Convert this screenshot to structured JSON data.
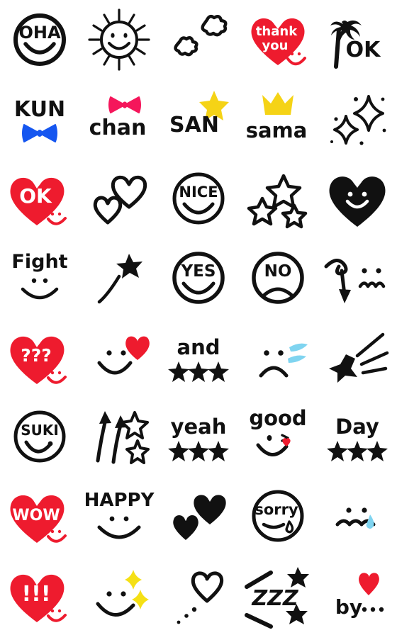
{
  "sheet": {
    "title": "Handwritten Emoji Sticker Set",
    "columns": 5,
    "rows": 8,
    "cell_size": 112,
    "background": "#ffffff"
  },
  "palette": {
    "ink": "#111111",
    "red": "#EE1B2E",
    "pink": "#F5165B",
    "blue": "#1556F0",
    "yellow": "#F5D316",
    "sparkle_yellow": "#F5E015",
    "tear_blue": "#7FD4F0",
    "white": "#FFFFFF"
  },
  "stickers": [
    {
      "id": "oha-circle-face",
      "row": 1,
      "col": 1,
      "text": "OHA",
      "kind": "circle-face-text",
      "mood": "smile",
      "colors": [
        "#111111",
        "#FFFFFF"
      ]
    },
    {
      "id": "sun-face",
      "row": 1,
      "col": 2,
      "text": "",
      "kind": "sun-face",
      "mood": "smile",
      "colors": [
        "#111111",
        "#FFFFFF"
      ]
    },
    {
      "id": "clouds",
      "row": 1,
      "col": 3,
      "text": "",
      "kind": "clouds",
      "mood": "none",
      "colors": [
        "#111111",
        "#FFFFFF"
      ]
    },
    {
      "id": "thank-you-heart",
      "row": 1,
      "col": 4,
      "text": "thank you",
      "kind": "heart-text",
      "mood": "smile",
      "colors": [
        "#EE1B2E",
        "#FFFFFF"
      ]
    },
    {
      "id": "palm-tree-ok",
      "row": 1,
      "col": 5,
      "text": "OK",
      "kind": "palm-tree-text",
      "mood": "none",
      "colors": [
        "#111111"
      ]
    },
    {
      "id": "kun-blue-bow",
      "row": 2,
      "col": 1,
      "text": "KUN",
      "kind": "text-with-bow",
      "mood": "none",
      "colors": [
        "#111111",
        "#1556F0"
      ]
    },
    {
      "id": "chan-pink-bow",
      "row": 2,
      "col": 2,
      "text": "chan",
      "kind": "text-with-bow",
      "mood": "none",
      "colors": [
        "#111111",
        "#F5165B"
      ]
    },
    {
      "id": "san-star",
      "row": 2,
      "col": 3,
      "text": "SAN",
      "kind": "text-with-star",
      "mood": "none",
      "colors": [
        "#111111",
        "#F5D316"
      ]
    },
    {
      "id": "sama-crown",
      "row": 2,
      "col": 4,
      "text": "sama",
      "kind": "text-with-crown",
      "mood": "none",
      "colors": [
        "#111111",
        "#F5D316"
      ]
    },
    {
      "id": "sparkles",
      "row": 2,
      "col": 5,
      "text": "",
      "kind": "sparkles",
      "mood": "none",
      "colors": [
        "#111111",
        "#FFFFFF"
      ]
    },
    {
      "id": "ok-heart",
      "row": 3,
      "col": 1,
      "text": "OK",
      "kind": "heart-text",
      "mood": "smile",
      "colors": [
        "#EE1B2E",
        "#FFFFFF"
      ]
    },
    {
      "id": "two-white-hearts",
      "row": 3,
      "col": 2,
      "text": "",
      "kind": "two-hearts",
      "mood": "none",
      "colors": [
        "#FFFFFF",
        "#111111"
      ]
    },
    {
      "id": "nice-circle-face",
      "row": 3,
      "col": 3,
      "text": "NICE",
      "kind": "circle-face-text",
      "mood": "smile",
      "colors": [
        "#111111",
        "#FFFFFF"
      ]
    },
    {
      "id": "three-white-stars",
      "row": 3,
      "col": 4,
      "text": "",
      "kind": "stars-outline",
      "mood": "none",
      "colors": [
        "#FFFFFF",
        "#111111"
      ]
    },
    {
      "id": "black-heart-face",
      "row": 3,
      "col": 5,
      "text": "",
      "kind": "heart-face",
      "mood": "smile",
      "colors": [
        "#111111",
        "#FFFFFF"
      ]
    },
    {
      "id": "fight-face",
      "row": 4,
      "col": 1,
      "text": "Fight",
      "kind": "text-over-face",
      "mood": "smile",
      "colors": [
        "#111111"
      ]
    },
    {
      "id": "shooting-star",
      "row": 4,
      "col": 2,
      "text": "",
      "kind": "shooting-star",
      "mood": "none",
      "colors": [
        "#111111"
      ]
    },
    {
      "id": "yes-circle-face",
      "row": 4,
      "col": 3,
      "text": "YES",
      "kind": "circle-face-text",
      "mood": "smile",
      "colors": [
        "#111111",
        "#FFFFFF"
      ]
    },
    {
      "id": "no-circle-face",
      "row": 4,
      "col": 4,
      "text": "NO",
      "kind": "circle-face-text",
      "mood": "frown",
      "colors": [
        "#111111",
        "#FFFFFF"
      ]
    },
    {
      "id": "arrow-wavy-face",
      "row": 4,
      "col": 5,
      "text": "",
      "kind": "arrow-face",
      "mood": "wavy",
      "colors": [
        "#111111"
      ]
    },
    {
      "id": "question-heart",
      "row": 5,
      "col": 1,
      "text": "???",
      "kind": "heart-text",
      "mood": "smile",
      "colors": [
        "#EE1B2E",
        "#FFFFFF"
      ]
    },
    {
      "id": "smile-red-heart",
      "row": 5,
      "col": 2,
      "text": "",
      "kind": "face-with-heart",
      "mood": "smile",
      "colors": [
        "#111111",
        "#EE1B2E"
      ]
    },
    {
      "id": "and-stars",
      "row": 5,
      "col": 3,
      "text": "and",
      "kind": "text-over-stars",
      "mood": "none",
      "colors": [
        "#111111"
      ]
    },
    {
      "id": "crying-face",
      "row": 5,
      "col": 4,
      "text": "",
      "kind": "face-with-tears",
      "mood": "frown",
      "colors": [
        "#111111",
        "#7FD4F0"
      ]
    },
    {
      "id": "star-burst",
      "row": 5,
      "col": 5,
      "text": "",
      "kind": "star-burst",
      "mood": "none",
      "colors": [
        "#111111"
      ]
    },
    {
      "id": "suki-circle-face",
      "row": 6,
      "col": 1,
      "text": "SUKI",
      "kind": "circle-face-text",
      "mood": "wink",
      "colors": [
        "#111111",
        "#FFFFFF"
      ]
    },
    {
      "id": "arrows-stars",
      "row": 6,
      "col": 2,
      "text": "",
      "kind": "arrows-stars",
      "mood": "none",
      "colors": [
        "#111111",
        "#FFFFFF"
      ]
    },
    {
      "id": "yeah-stars",
      "row": 6,
      "col": 3,
      "text": "yeah",
      "kind": "text-over-stars",
      "mood": "none",
      "colors": [
        "#111111"
      ]
    },
    {
      "id": "good-face",
      "row": 6,
      "col": 4,
      "text": "good",
      "kind": "text-over-face",
      "mood": "wink",
      "colors": [
        "#111111",
        "#EE1B2E"
      ]
    },
    {
      "id": "day-stars",
      "row": 6,
      "col": 5,
      "text": "Day",
      "kind": "text-over-stars",
      "mood": "none",
      "colors": [
        "#111111"
      ]
    },
    {
      "id": "wow-heart",
      "row": 7,
      "col": 1,
      "text": "WOW",
      "kind": "heart-text",
      "mood": "smile",
      "colors": [
        "#EE1B2E",
        "#FFFFFF"
      ]
    },
    {
      "id": "happy-face",
      "row": 7,
      "col": 2,
      "text": "HAPPY",
      "kind": "text-over-face",
      "mood": "smile",
      "colors": [
        "#111111"
      ]
    },
    {
      "id": "two-black-hearts",
      "row": 7,
      "col": 3,
      "text": "",
      "kind": "two-hearts",
      "mood": "none",
      "colors": [
        "#111111"
      ]
    },
    {
      "id": "sorry-circle-face",
      "row": 7,
      "col": 4,
      "text": "sorry",
      "kind": "circle-face-text",
      "mood": "tear",
      "colors": [
        "#111111",
        "#FFFFFF"
      ]
    },
    {
      "id": "sad-tear-face",
      "row": 7,
      "col": 5,
      "text": "",
      "kind": "face-with-tears",
      "mood": "wavy",
      "colors": [
        "#111111",
        "#7FD4F0"
      ]
    },
    {
      "id": "exclaim-heart",
      "row": 8,
      "col": 1,
      "text": "!!!",
      "kind": "heart-text",
      "mood": "smile",
      "colors": [
        "#EE1B2E",
        "#FFFFFF"
      ]
    },
    {
      "id": "sparkle-face",
      "row": 8,
      "col": 2,
      "text": "",
      "kind": "face-with-sparkles",
      "mood": "smile",
      "colors": [
        "#111111",
        "#F5E015"
      ]
    },
    {
      "id": "heart-thought",
      "row": 8,
      "col": 3,
      "text": "",
      "kind": "heart-thought",
      "mood": "none",
      "colors": [
        "#FFFFFF",
        "#111111"
      ]
    },
    {
      "id": "zzz-sleep",
      "row": 8,
      "col": 4,
      "text": "ZZZ",
      "kind": "zzz",
      "mood": "none",
      "colors": [
        "#111111"
      ]
    },
    {
      "id": "by-heart",
      "row": 8,
      "col": 5,
      "text": "by...",
      "kind": "text-with-heart",
      "mood": "none",
      "colors": [
        "#111111",
        "#EE1B2E"
      ]
    }
  ]
}
